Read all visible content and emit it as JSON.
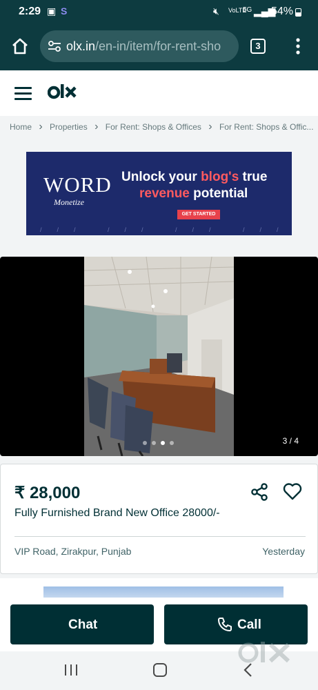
{
  "status": {
    "time": "2:29",
    "battery": "54%"
  },
  "browser": {
    "url_host": "olx.in",
    "url_path": "/en-in/item/for-rent-sho",
    "tab_count": "3"
  },
  "breadcrumb": [
    "Home",
    "Properties",
    "For Rent: Shops & Offices",
    "For Rent: Shops & Offic..."
  ],
  "ad": {
    "brand_line1": "WORD",
    "brand_line2": "Monetize",
    "headline1_a": "Unlock your ",
    "headline1_b": "blog's",
    "headline1_c": " true",
    "headline2": "revenue potential",
    "cta": "GET STARTED"
  },
  "gallery": {
    "counter": "3 / 4",
    "current": 3,
    "total": 4
  },
  "listing": {
    "price": "₹ 28,000",
    "title": "Fully Furnished Brand New Office 28000/-",
    "location": "VIP Road, Zirakpur, Punjab",
    "posted": "Yesterday"
  },
  "actions": {
    "chat_label": "Chat",
    "call_label": "Call"
  },
  "colors": {
    "primary": "#002f34",
    "browser_chrome": "#0d3b40",
    "ad_background": "#1d2a6b",
    "ad_accent": "#ff5a5f"
  }
}
